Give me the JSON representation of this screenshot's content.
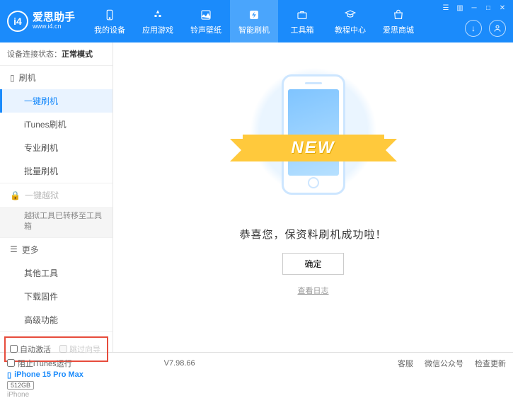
{
  "brand": {
    "name": "爱思助手",
    "url": "www.i4.cn",
    "logo_letter": "i4"
  },
  "nav": [
    {
      "label": "我的设备"
    },
    {
      "label": "应用游戏"
    },
    {
      "label": "铃声壁纸"
    },
    {
      "label": "智能刷机",
      "active": true
    },
    {
      "label": "工具箱"
    },
    {
      "label": "教程中心"
    },
    {
      "label": "爱思商城"
    }
  ],
  "conn_status": {
    "prefix": "设备连接状态：",
    "value": "正常模式"
  },
  "sidebar": {
    "flash": {
      "title": "刷机",
      "items": [
        "一键刷机",
        "iTunes刷机",
        "专业刷机",
        "批量刷机"
      ],
      "active_index": 0
    },
    "jailbreak": {
      "title": "一键越狱",
      "info": "越狱工具已转移至工具箱"
    },
    "more": {
      "title": "更多",
      "items": [
        "其他工具",
        "下载固件",
        "高级功能"
      ]
    }
  },
  "checks": {
    "auto_activate": "自动激活",
    "skip_guide": "跳过向导"
  },
  "device": {
    "name": "iPhone 15 Pro Max",
    "capacity": "512GB",
    "type": "iPhone"
  },
  "main": {
    "ribbon": "NEW",
    "message": "恭喜您，保资料刷机成功啦！",
    "ok": "确定",
    "log": "查看日志"
  },
  "footer": {
    "block_itunes": "阻止iTunes运行",
    "version": "V7.98.66",
    "links": [
      "客服",
      "微信公众号",
      "检查更新"
    ]
  }
}
